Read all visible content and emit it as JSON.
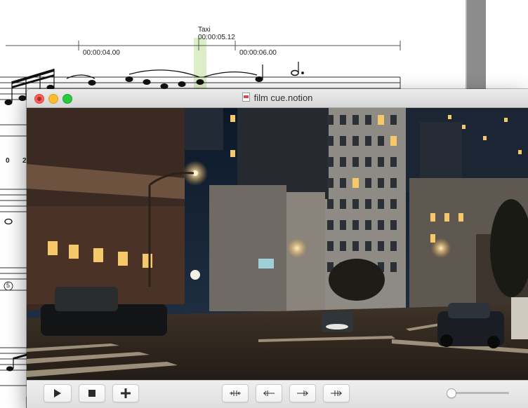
{
  "score": {
    "cue_marker": {
      "name": "Taxi",
      "time": "00:00:05.12"
    },
    "timecodes": [
      "00:00:04.00",
      "00:00:06.00"
    ],
    "measure_numbers": [
      "0",
      "2"
    ],
    "rehearsal_mark": "5"
  },
  "window": {
    "title": "film cue.notion"
  },
  "controls": {
    "play_label": "Play",
    "stop_label": "Stop",
    "add_label": "Add",
    "nudge_buttons": [
      "Jump to start",
      "Step back",
      "Step forward",
      "Jump to end"
    ],
    "volume": 0.0
  },
  "colors": {
    "close": "#fc5f57",
    "minimize": "#fdbc2e",
    "zoom": "#29c840",
    "cue_highlight": "#dceec7"
  }
}
